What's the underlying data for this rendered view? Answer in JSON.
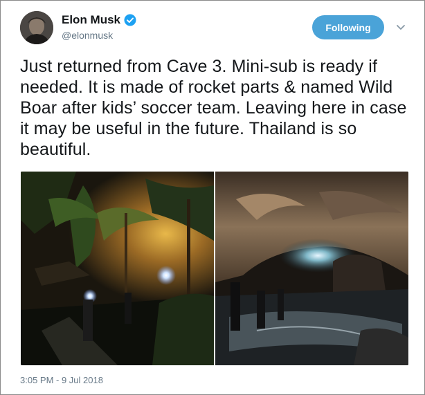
{
  "author": {
    "display_name": "Elon Musk",
    "handle": "@elonmusk",
    "verified": true,
    "avatar_icon": "avatar-photo"
  },
  "actions": {
    "follow_label": "Following",
    "caret_icon": "chevron-down-icon"
  },
  "tweet": {
    "text": "Just returned from Cave 3. Mini-sub is ready if needed. It is made of rocket parts & named Wild Boar after kids’ soccer team. Leaving here in case it may be useful in the future. Thailand is so beautiful.",
    "timestamp": "3:05 PM - 9 Jul 2018"
  },
  "media": {
    "photos": [
      {
        "name": "night-camp-photo"
      },
      {
        "name": "cave-entrance-photo"
      }
    ]
  },
  "colors": {
    "follow_button": "#4aa3d8",
    "verified": "#1da1f2",
    "secondary_text": "#657786"
  }
}
